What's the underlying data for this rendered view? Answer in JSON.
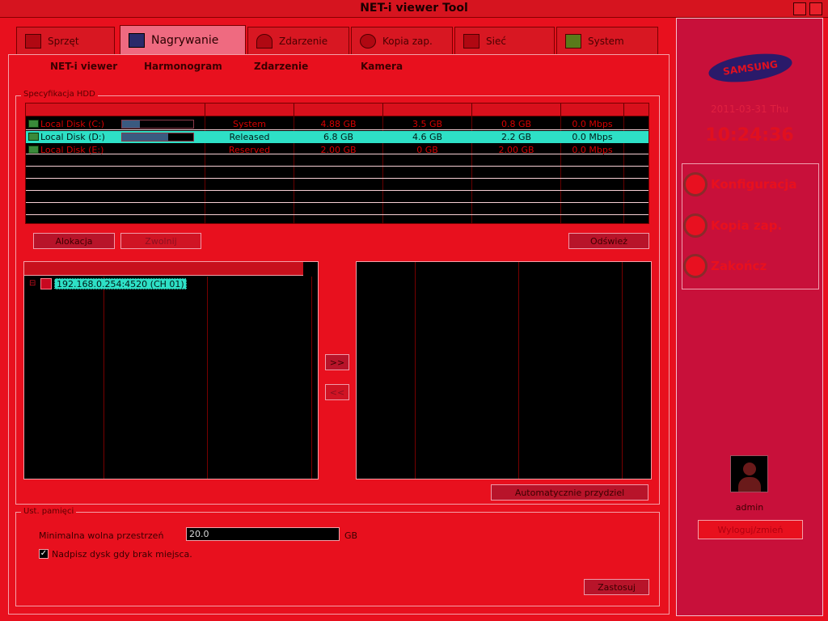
{
  "window": {
    "title": "NET-i viewer Tool"
  },
  "tabs": [
    {
      "label": "Sprzęt",
      "icon": "hardware-icon"
    },
    {
      "label": "Nagrywanie",
      "icon": "recording-icon"
    },
    {
      "label": "Zdarzenie",
      "icon": "alarm-bell-icon"
    },
    {
      "label": "Kopia zap.",
      "icon": "backup-icon"
    },
    {
      "label": "Sieć",
      "icon": "network-icon"
    },
    {
      "label": "System",
      "icon": "system-icon"
    }
  ],
  "subtabs": [
    "NET-i viewer",
    "Harmonogram",
    "Zdarzenie",
    "Kamera"
  ],
  "disk_group": {
    "legend": "Specyfikacja HDD"
  },
  "disks": [
    {
      "name": "Local Disk (C:)",
      "usage": 0.25,
      "status": "System",
      "total": "4.88 GB",
      "used": "3.5 GB",
      "free": "0.8 GB",
      "speed": "0.0 Mbps"
    },
    {
      "name": "Local Disk (D:)",
      "usage": 0.65,
      "status": "Released",
      "total": "6.8 GB",
      "used": "4.6 GB",
      "free": "2.2 GB",
      "speed": "0.0 Mbps"
    },
    {
      "name": "Local Disk (E:)",
      "usage": 0.0,
      "status": "Reserved",
      "total": "2.00 GB",
      "used": "0 GB",
      "free": "2.00 GB",
      "speed": "0.0 Mbps"
    }
  ],
  "buttons": {
    "allocate": "Alokacja",
    "release": "Zwolnij",
    "refresh": "Odśwież",
    "add": ">>",
    "remove": "<<",
    "auto": "Automatycznie przydziel",
    "apply": "Zastosuj"
  },
  "device_tree": {
    "item": "192.168.0.254:4520 (CH 01)"
  },
  "options": {
    "legend": "Ust. pamięci",
    "min_space_label": "Minimalna wolna przestrzeń",
    "min_space_value": "20.0",
    "min_space_unit": "GB",
    "overwrite_label": "Nadpisz dysk gdy brak miejsca."
  },
  "sidebar": {
    "logo": "SAMSUNG",
    "date": "2011-03-31 Thu",
    "time": "10:24:36",
    "menu": [
      {
        "label": "Konfiguracja",
        "icon": "gear-icon"
      },
      {
        "label": "Kopia zap.",
        "icon": "backup-icon"
      },
      {
        "label": "Zakończ",
        "icon": "power-icon"
      }
    ],
    "user": "admin",
    "change_user": "Wyloguj/zmień"
  }
}
